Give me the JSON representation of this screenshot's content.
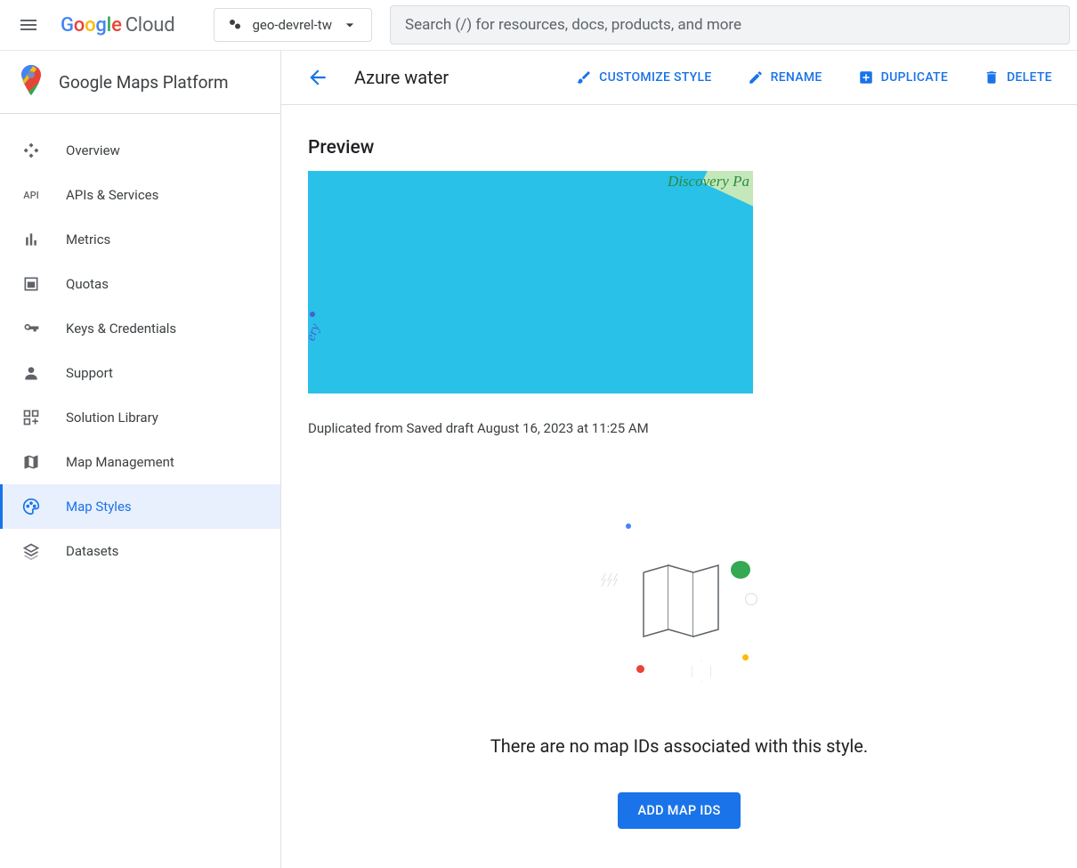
{
  "header": {
    "logo_cloud": "Cloud",
    "project_name": "geo-devrel-tw",
    "search_placeholder": "Search (/) for resources, docs, products, and more"
  },
  "sidebar": {
    "title": "Google Maps Platform",
    "items": [
      {
        "label": "Overview"
      },
      {
        "label": "APIs & Services"
      },
      {
        "label": "Metrics"
      },
      {
        "label": "Quotas"
      },
      {
        "label": "Keys & Credentials"
      },
      {
        "label": "Support"
      },
      {
        "label": "Solution Library"
      },
      {
        "label": "Map Management"
      },
      {
        "label": "Map Styles"
      },
      {
        "label": "Datasets"
      }
    ]
  },
  "page": {
    "title": "Azure water",
    "actions": {
      "customize": "CUSTOMIZE STYLE",
      "rename": "RENAME",
      "duplicate": "DUPLICATE",
      "delete": "DELETE"
    },
    "preview_heading": "Preview",
    "preview_labels": {
      "discovery": "Discovery Pa",
      "ferry": "ery"
    },
    "duplicated_from": "Duplicated from Saved draft August 16, 2023 at 11:25 AM",
    "empty_state_message": "There are no map IDs associated with this style.",
    "add_button": "ADD MAP IDS"
  }
}
